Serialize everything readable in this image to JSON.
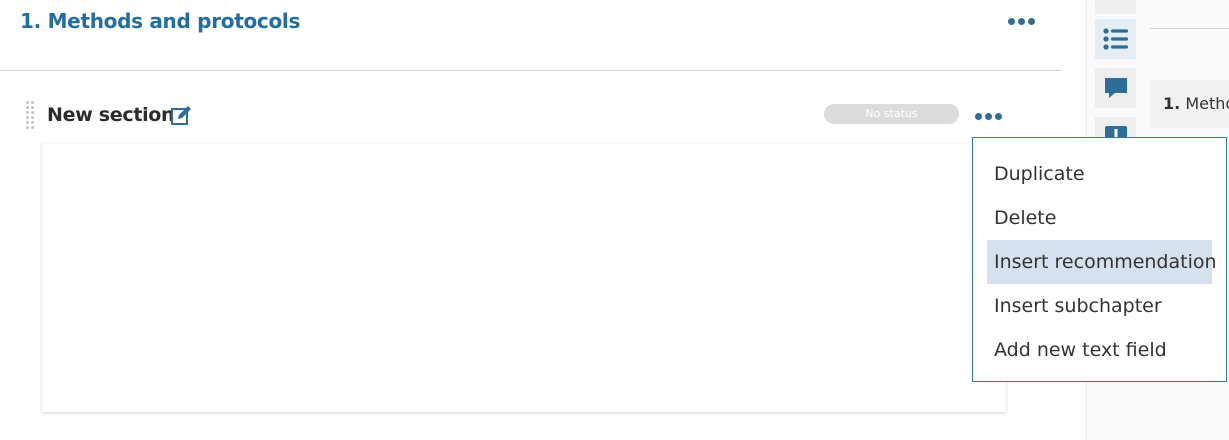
{
  "chapter": {
    "title": "1. Methods and protocols"
  },
  "section": {
    "title": "New section",
    "status": "No status"
  },
  "context_menu": {
    "items": [
      {
        "label": "Duplicate"
      },
      {
        "label": "Delete"
      },
      {
        "label": "Insert recommendation",
        "highlighted": true
      },
      {
        "label": "Insert subchapter"
      },
      {
        "label": "Add new text field"
      }
    ]
  },
  "side_panel": {
    "buttons": [
      "chevron-icon",
      "list-icon",
      "comment-icon",
      "alert-icon"
    ],
    "toc": {
      "number": "1.",
      "text": "Methods and protocols"
    }
  },
  "colors": {
    "accent": "#1f6fa5",
    "menu_border": "#2f7aa8",
    "menu_highlight": "#d5e1ee",
    "status_badge": "#dcdcdc"
  }
}
